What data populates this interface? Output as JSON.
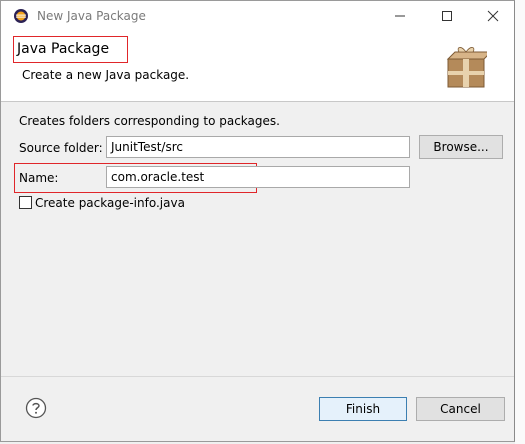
{
  "window": {
    "title": "New Java Package"
  },
  "header": {
    "title": "Java Package",
    "description": "Create a new Java package."
  },
  "form": {
    "description": "Creates folders corresponding to packages.",
    "source_folder_label": "Source folder:",
    "source_folder_value": "JunitTest/src",
    "browse_label": "Browse...",
    "name_label": "Name:",
    "name_value": "com.oracle.test",
    "create_info_label": "Create package-info.java",
    "create_info_checked": false
  },
  "footer": {
    "finish_label": "Finish",
    "cancel_label": "Cancel"
  },
  "colors": {
    "highlight_border": "#e0262a",
    "primary_button_border": "#3c7fb1"
  },
  "icons": [
    "eclipse-app-icon",
    "minimize-icon",
    "maximize-icon",
    "close-icon",
    "package-icon",
    "help-icon"
  ]
}
